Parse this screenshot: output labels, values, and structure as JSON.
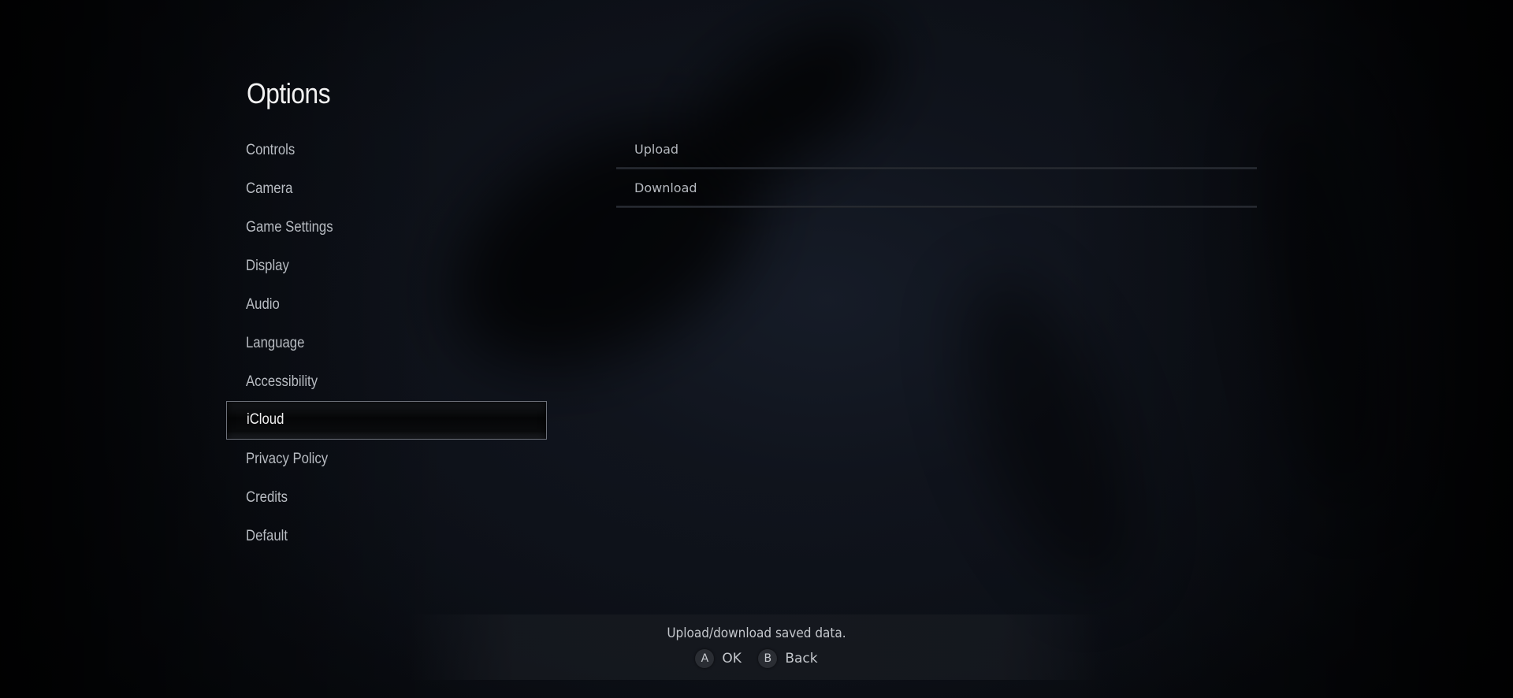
{
  "page": {
    "title": "Options"
  },
  "menu": {
    "selected_index": 7,
    "items": [
      {
        "label": "Controls"
      },
      {
        "label": "Camera"
      },
      {
        "label": "Game Settings"
      },
      {
        "label": "Display"
      },
      {
        "label": "Audio"
      },
      {
        "label": "Language"
      },
      {
        "label": "Accessibility"
      },
      {
        "label": "iCloud"
      },
      {
        "label": "Privacy Policy"
      },
      {
        "label": "Credits"
      },
      {
        "label": "Default"
      }
    ]
  },
  "submenu": {
    "items": [
      {
        "label": "Upload"
      },
      {
        "label": "Download"
      }
    ]
  },
  "footer": {
    "hint": "Upload/download saved data.",
    "actions": [
      {
        "button": "A",
        "label": "OK"
      },
      {
        "button": "B",
        "label": "Back"
      }
    ]
  },
  "colors": {
    "background": "#10141d",
    "text": "#b8bcc2",
    "selected_border": "#6d717a"
  }
}
